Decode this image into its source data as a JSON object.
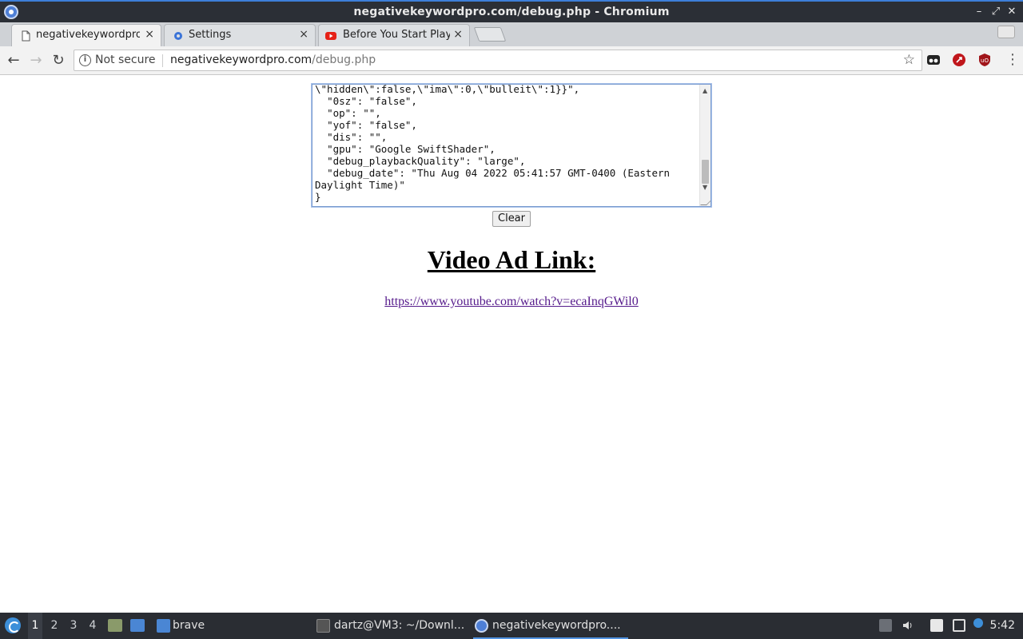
{
  "window": {
    "title": "negativekeywordpro.com/debug.php - Chromium"
  },
  "tabs": [
    {
      "label": "negativekeywordpro",
      "close": "×",
      "favicon": "page-icon"
    },
    {
      "label": "Settings",
      "close": "×",
      "favicon": "gear-icon"
    },
    {
      "label": "Before You Start Play",
      "close": "×",
      "favicon": "youtube-icon"
    }
  ],
  "toolbar": {
    "security_label": "Not secure",
    "url_host": "negativekeywordpro.com",
    "url_path": "/debug.php"
  },
  "page": {
    "debug_text": "\\\"hidden\\\":false,\\\"ima\\\":0,\\\"bulleit\\\":1}}\",\n  \"0sz\": \"false\",\n  \"op\": \"\",\n  \"yof\": \"false\",\n  \"dis\": \"\",\n  \"gpu\": \"Google SwiftShader\",\n  \"debug_playbackQuality\": \"large\",\n  \"debug_date\": \"Thu Aug 04 2022 05:41:57 GMT-0400 (Eastern\nDaylight Time)\"\n}",
    "clear_label": "Clear",
    "heading": "Video Ad Link:",
    "video_url": "https://www.youtube.com/watch?v=ecaInqGWil0"
  },
  "taskbar": {
    "workspaces": [
      "1",
      "2",
      "3",
      "4"
    ],
    "active_workspace": "1",
    "launcher_label": "brave",
    "tasks": [
      {
        "label": "dartz@VM3: ~/Downl...",
        "icon": "terminal-icon"
      },
      {
        "label": "negativekeywordpro....",
        "icon": "chromium-icon"
      }
    ],
    "clock": "5:42"
  },
  "colors": {
    "titlebar": "#2b2f36",
    "accent": "#3d7fd9",
    "link_visited": "#551a8b",
    "taskbar": "#2a2d33"
  }
}
